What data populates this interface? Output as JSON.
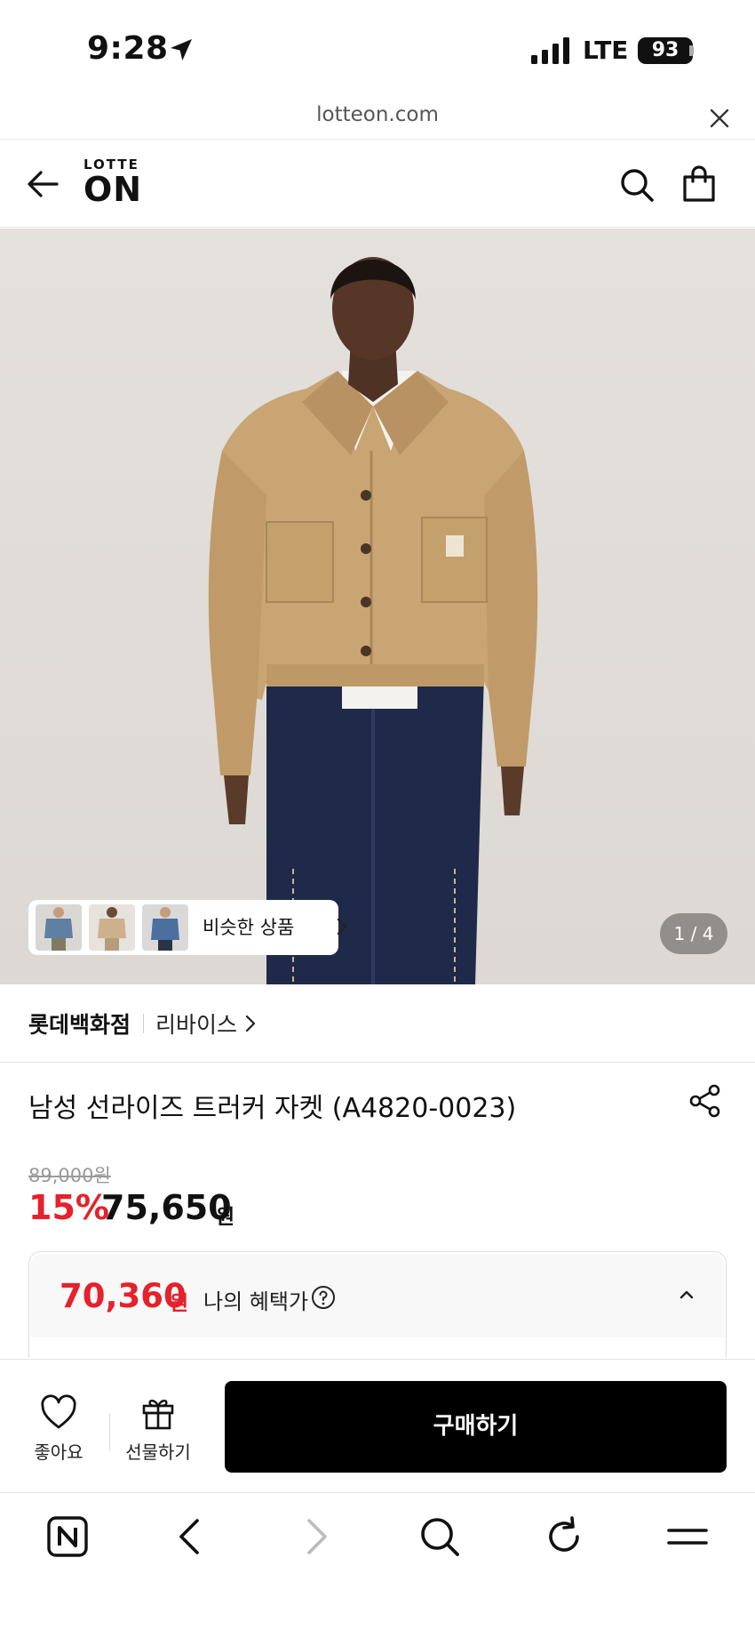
{
  "status_bar": {
    "time": "9:28",
    "network": "LTE",
    "battery": "93"
  },
  "browser": {
    "url": "lotteon.com"
  },
  "header": {
    "logo_top": "LOTTE",
    "logo_bottom": "ON"
  },
  "gallery": {
    "similar_label": "비슷한 상품",
    "counter": "1 / 4",
    "thumbnails": [
      "denim-jacket",
      "beige-jacket",
      "blue-shirt"
    ]
  },
  "brand": {
    "store": "롯데백화점",
    "name": "리바이스"
  },
  "product": {
    "title": "남성 선라이즈 트러커 자켓 (A4820-0023)",
    "original_price": "89,000원",
    "discount": "15%",
    "sale_price": "75,650",
    "sale_unit": "원"
  },
  "benefit": {
    "price": "70,360",
    "unit": "원",
    "label": "나의 혜택가"
  },
  "actions": {
    "like_label": "좋아요",
    "gift_label": "선물하기",
    "buy_label": "구매하기"
  },
  "colors": {
    "accent_red": "#e5212b",
    "buy_button": "#000000"
  }
}
